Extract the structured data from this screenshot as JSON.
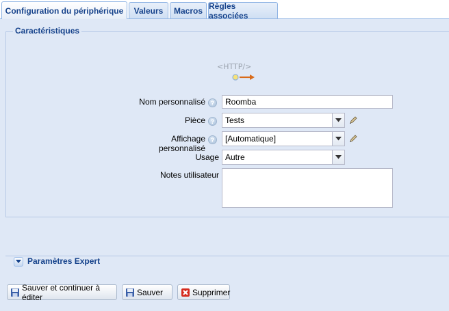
{
  "tabs": [
    {
      "label": "Configuration du périphérique",
      "active": true
    },
    {
      "label": "Valeurs",
      "active": false
    },
    {
      "label": "Macros",
      "active": false
    },
    {
      "label": "Règles associées",
      "active": false
    }
  ],
  "characteristics": {
    "legend": "Caractéristiques",
    "logo_text": "<HTTP/>",
    "fields": {
      "name": {
        "label": "Nom personnalisé",
        "value": "Roomba"
      },
      "room": {
        "label": "Pièce",
        "value": "Tests"
      },
      "display": {
        "label": "Affichage personnalisé",
        "value": "[Automatique]"
      },
      "usage": {
        "label": "Usage",
        "value": "Autre"
      },
      "notes": {
        "label": "Notes utilisateur",
        "value": ""
      }
    },
    "help_glyph": "?"
  },
  "expert": {
    "label": "Paramètres Expert"
  },
  "buttons": {
    "save_continue": "Sauver et continuer à éditer",
    "save": "Sauver",
    "delete": "Supprimer"
  },
  "icons": {
    "help": "help-icon",
    "dropdown": "chevron-down-icon",
    "edit": "pencil-icon",
    "save": "floppy-disk-icon",
    "delete": "red-x-icon",
    "toggle": "expand-toggle-icon"
  },
  "colors": {
    "panel_bg": "#dfe8f6",
    "header_text": "#15428b",
    "border": "#8db2e3",
    "delete_red": "#d52b1e"
  }
}
